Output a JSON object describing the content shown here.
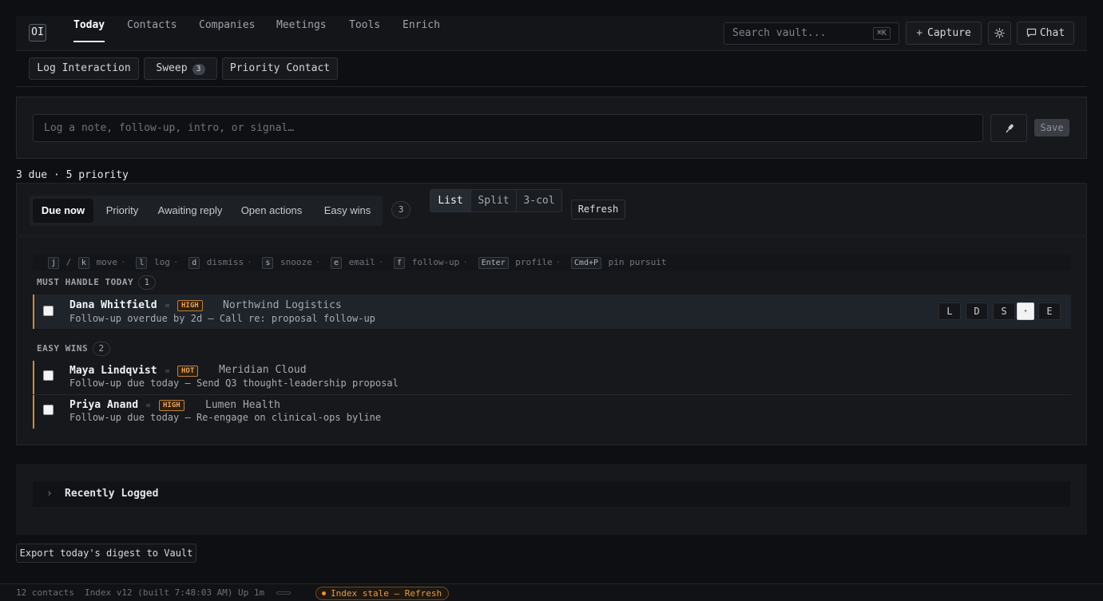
{
  "app": {
    "logo_text": "OI"
  },
  "nav": {
    "tabs": [
      {
        "label": "Today",
        "active": true
      },
      {
        "label": "Contacts"
      },
      {
        "label": "Companies"
      },
      {
        "label": "Meetings"
      },
      {
        "label": "Tools"
      },
      {
        "label": "Enrich"
      }
    ],
    "search_placeholder": "Search vault...",
    "search_shortcut": "⌘K",
    "capture_label": "Capture",
    "chat_label": "Chat",
    "theme_icon": "sun-icon"
  },
  "actions": {
    "log_interaction": "Log Interaction",
    "sweep": "Sweep",
    "sweep_count": "3",
    "priority_contact": "Priority Contact"
  },
  "capture": {
    "placeholder": "Log a note, follow-up, intro, or signal…",
    "save_label": "Save"
  },
  "summary": "3 due · 5 priority",
  "filters": {
    "tabs": [
      {
        "label": "Due now",
        "active": true
      },
      {
        "label": "Priority"
      },
      {
        "label": "Awaiting reply"
      },
      {
        "label": "Open actions"
      },
      {
        "label": "Easy wins"
      }
    ],
    "count": "3",
    "views": [
      {
        "label": "List",
        "active": true
      },
      {
        "label": "Split"
      },
      {
        "label": "3-col"
      }
    ],
    "refresh_label": "Refresh"
  },
  "shortcuts": [
    {
      "keys": [
        "j",
        "k"
      ],
      "label": "move"
    },
    {
      "keys": [
        "l"
      ],
      "label": "log"
    },
    {
      "keys": [
        "d"
      ],
      "label": "dismiss"
    },
    {
      "keys": [
        "s"
      ],
      "label": "snooze"
    },
    {
      "keys": [
        "e"
      ],
      "label": "email"
    },
    {
      "keys": [
        "f"
      ],
      "label": "follow-up"
    },
    {
      "keys": [
        "Enter"
      ],
      "label": "profile"
    },
    {
      "keys": [
        "Cmd+P"
      ],
      "label": "pin pursuit"
    }
  ],
  "sections": [
    {
      "title": "MUST HANDLE TODAY",
      "count": "1",
      "rows": [
        {
          "name": "Dana Whitfield",
          "mail_icon": "✉",
          "tag": "HIGH",
          "company": "Northwind Logistics",
          "detail": "Follow-up overdue by 2d — Call re: proposal follow-up",
          "actions": [
            "L",
            "D",
            "S",
            "▾",
            "E"
          ]
        }
      ]
    },
    {
      "title": "EASY WINS",
      "count": "2",
      "rows": [
        {
          "name": "Maya Lindqvist",
          "mail_icon": "✉",
          "tag": "HOT",
          "company": "Meridian Cloud",
          "detail": "Follow-up due today — Send Q3 thought-leadership proposal"
        },
        {
          "name": "Priya Anand",
          "mail_icon": "✉",
          "tag": "HIGH",
          "company": "Lumen Health",
          "detail": "Follow-up due today — Re-engage on clinical-ops byline"
        }
      ]
    }
  ],
  "recent": {
    "title": "Recently Logged",
    "chevron": "›"
  },
  "export_label": "Export today's digest to Vault",
  "status": {
    "contacts": "12 contacts",
    "index": "Index v12 (built 7:48:03 AM)",
    "uptime": "Up 1m",
    "stale": "Index stale — Refresh"
  },
  "colors": {
    "accent": "#d08a3a",
    "background": "#0d0f12"
  }
}
